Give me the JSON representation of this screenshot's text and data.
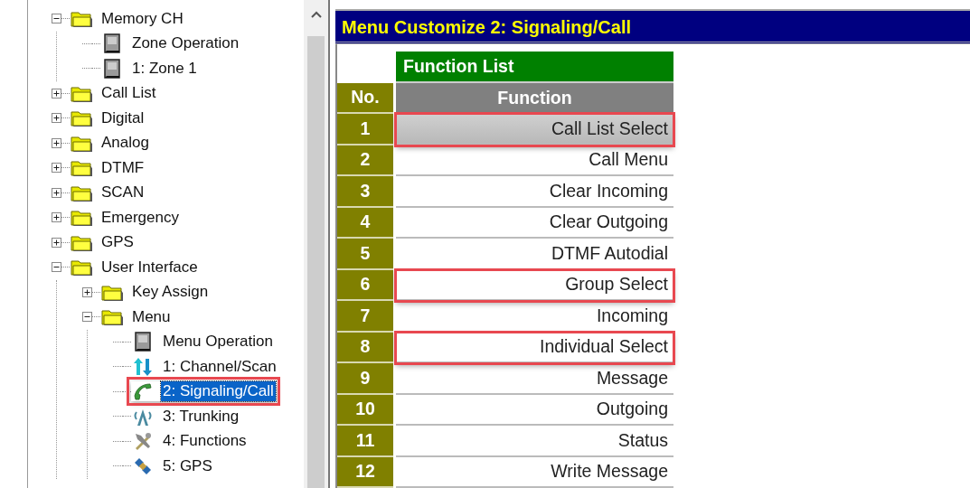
{
  "tree": {
    "items": [
      {
        "label": "Memory CH",
        "kind": "folder",
        "expanded": true,
        "selected": false,
        "highlighted": false,
        "children": [
          {
            "label": "Zone Operation",
            "kind": "document",
            "selected": false,
            "highlighted": false
          },
          {
            "label": "1: Zone 1",
            "kind": "document",
            "selected": false,
            "highlighted": false
          }
        ]
      },
      {
        "label": "Call List",
        "kind": "folder",
        "expanded": false,
        "selected": false,
        "highlighted": false
      },
      {
        "label": "Digital",
        "kind": "folder",
        "expanded": false,
        "selected": false,
        "highlighted": false
      },
      {
        "label": "Analog",
        "kind": "folder",
        "expanded": false,
        "selected": false,
        "highlighted": false
      },
      {
        "label": "DTMF",
        "kind": "folder",
        "expanded": false,
        "selected": false,
        "highlighted": false
      },
      {
        "label": "SCAN",
        "kind": "folder",
        "expanded": false,
        "selected": false,
        "highlighted": false
      },
      {
        "label": "Emergency",
        "kind": "folder",
        "expanded": false,
        "selected": false,
        "highlighted": false
      },
      {
        "label": "GPS",
        "kind": "folder",
        "expanded": false,
        "selected": false,
        "highlighted": false
      },
      {
        "label": "User Interface",
        "kind": "folder",
        "expanded": true,
        "selected": false,
        "highlighted": false,
        "children": [
          {
            "label": "Key Assign",
            "kind": "folder",
            "expanded": false,
            "selected": false,
            "highlighted": false
          },
          {
            "label": "Menu",
            "kind": "folder",
            "expanded": true,
            "selected": false,
            "highlighted": false,
            "children": [
              {
                "label": "Menu Operation",
                "kind": "document",
                "selected": false,
                "highlighted": false
              },
              {
                "label": "1: Channel/Scan",
                "kind": "arrows",
                "selected": false,
                "highlighted": false
              },
              {
                "label": "2: Signaling/Call",
                "kind": "phone",
                "selected": true,
                "highlighted": true
              },
              {
                "label": "3: Trunking",
                "kind": "tower",
                "selected": false,
                "highlighted": false
              },
              {
                "label": "4: Functions",
                "kind": "tools",
                "selected": false,
                "highlighted": false
              },
              {
                "label": "5: GPS",
                "kind": "satellite",
                "selected": false,
                "highlighted": false
              }
            ]
          }
        ]
      }
    ]
  },
  "panel": {
    "title": "Menu Customize 2: Signaling/Call",
    "table": {
      "group_header": "Function List",
      "columns": [
        "No.",
        "Function"
      ],
      "rows": [
        {
          "no": "1",
          "function": "Call List Select",
          "selected": true,
          "highlighted": true
        },
        {
          "no": "2",
          "function": "Call Menu",
          "selected": false,
          "highlighted": false
        },
        {
          "no": "3",
          "function": "Clear Incoming",
          "selected": false,
          "highlighted": false
        },
        {
          "no": "4",
          "function": "Clear Outgoing",
          "selected": false,
          "highlighted": false
        },
        {
          "no": "5",
          "function": "DTMF Autodial",
          "selected": false,
          "highlighted": false
        },
        {
          "no": "6",
          "function": "Group Select",
          "selected": false,
          "highlighted": true
        },
        {
          "no": "7",
          "function": "Incoming",
          "selected": false,
          "highlighted": false
        },
        {
          "no": "8",
          "function": "Individual Select",
          "selected": false,
          "highlighted": true
        },
        {
          "no": "9",
          "function": "Message",
          "selected": false,
          "highlighted": false
        },
        {
          "no": "10",
          "function": "Outgoing",
          "selected": false,
          "highlighted": false
        },
        {
          "no": "11",
          "function": "Status",
          "selected": false,
          "highlighted": false
        },
        {
          "no": "12",
          "function": "Write Message",
          "selected": false,
          "highlighted": false
        }
      ]
    }
  }
}
